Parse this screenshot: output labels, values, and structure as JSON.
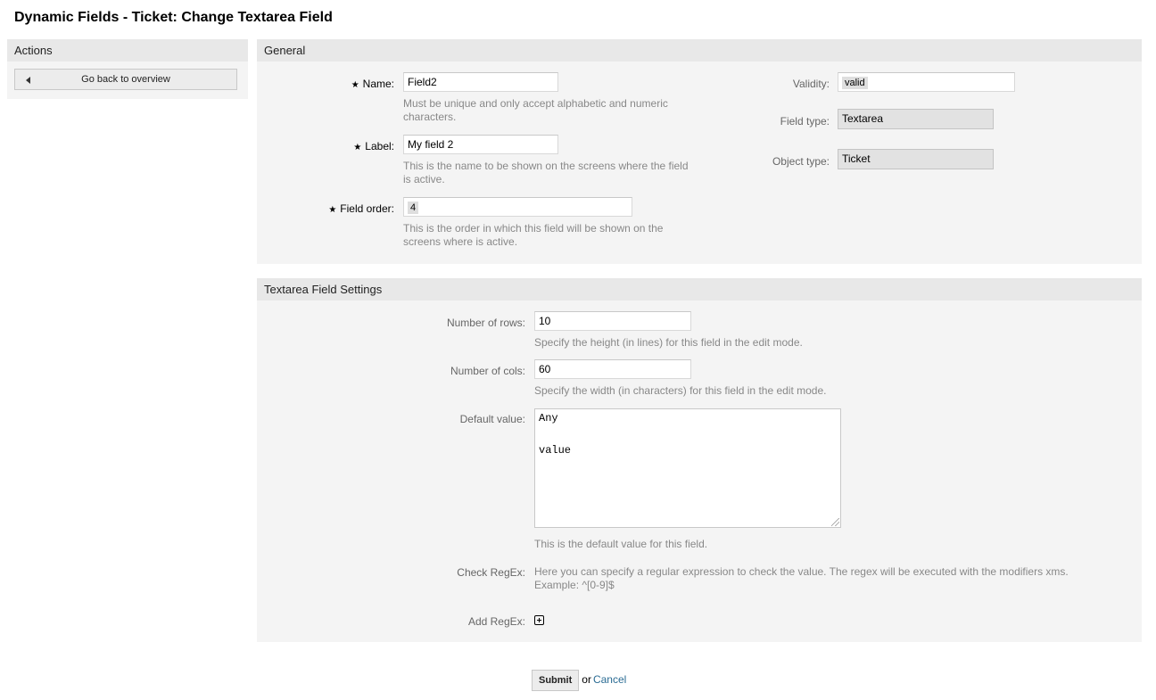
{
  "page": {
    "title": "Dynamic Fields - Ticket: Change Textarea Field"
  },
  "sidebar": {
    "header": "Actions",
    "back_button": "Go back to overview"
  },
  "general": {
    "header": "General",
    "name": {
      "label": "Name:",
      "value": "Field2",
      "hint": "Must be unique and only accept alphabetic and numeric characters."
    },
    "label": {
      "label": "Label:",
      "value": "My field 2",
      "hint": "This is the name to be shown on the screens where the field is active."
    },
    "field_order": {
      "label": "Field order:",
      "value": "4",
      "hint": "This is the order in which this field will be shown on the screens where is active."
    },
    "validity": {
      "label": "Validity:",
      "value": "valid"
    },
    "field_type": {
      "label": "Field type:",
      "value": "Textarea"
    },
    "object_type": {
      "label": "Object type:",
      "value": "Ticket"
    },
    "required_marker": "★"
  },
  "settings": {
    "header": "Textarea Field Settings",
    "rows": {
      "label": "Number of rows:",
      "value": "10",
      "hint": "Specify the height (in lines) for this field in the edit mode."
    },
    "cols": {
      "label": "Number of cols:",
      "value": "60",
      "hint": "Specify the width (in characters) for this field in the edit mode."
    },
    "default_value": {
      "label": "Default value:",
      "line1": "Any",
      "line2": "value",
      "hint": "This is the default value for this field."
    },
    "check_regex": {
      "label": "Check RegEx:",
      "text1": "Here you can specify a regular expression to check the value. The regex will be executed with the modifiers xms.",
      "text2": "Example: ^[0-9]$"
    },
    "add_regex": {
      "label": "Add RegEx:"
    }
  },
  "footer": {
    "submit": "Submit",
    "or": "or",
    "cancel": "Cancel"
  }
}
